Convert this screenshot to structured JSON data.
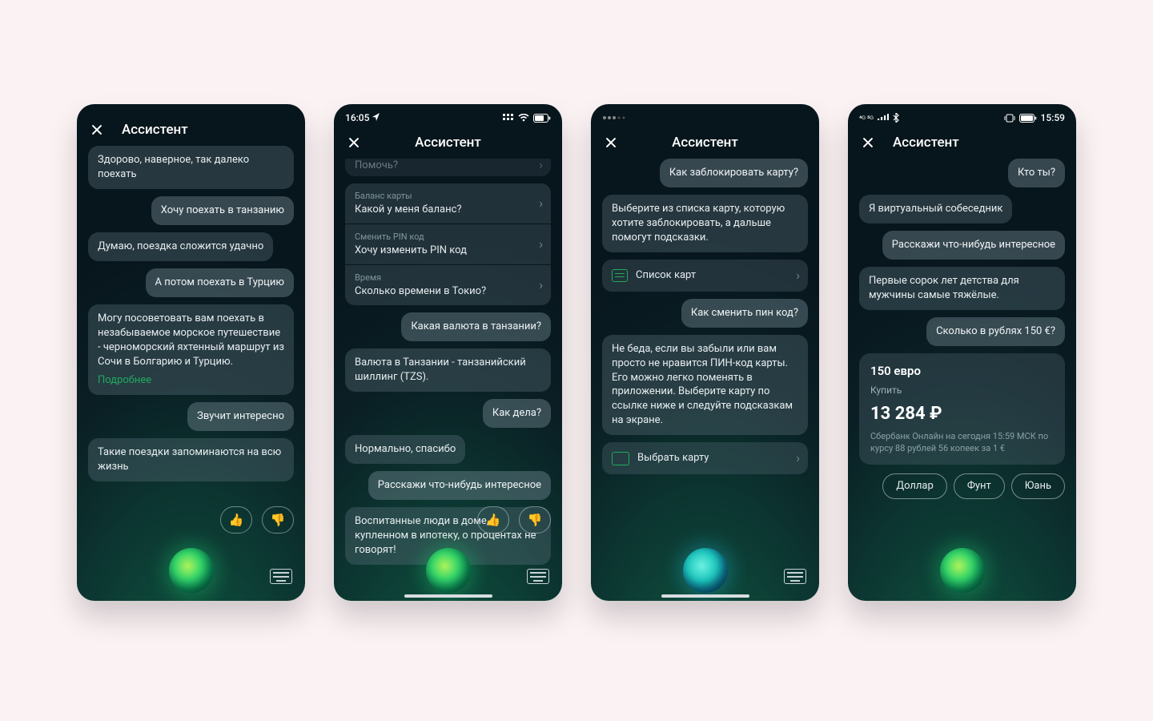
{
  "screens": [
    {
      "layout": "left",
      "title": "Ассистент",
      "statusbar": null,
      "orb": "green",
      "keyboard": true,
      "reactions": true,
      "home_indicator": false,
      "items": [
        {
          "t": "assist",
          "text": "Здорово, наверное, так далеко поехать"
        },
        {
          "t": "user",
          "text": "Хочу поехать в танзанию"
        },
        {
          "t": "assist",
          "text": "Думаю, поездка сложится удачно"
        },
        {
          "t": "user",
          "text": "А потом поехать в Турцию"
        },
        {
          "t": "assist",
          "text": "Могу посоветовать вам поехать в незабываемое морское путешествие - черноморский яхтенный маршрут из Сочи в Болгарию и Турцию.",
          "link": "Подробнее"
        },
        {
          "t": "user",
          "text": "Звучит интересно"
        },
        {
          "t": "assist",
          "text": "Такие поездки запоминаются на всю жизнь"
        }
      ]
    },
    {
      "layout": "center",
      "title": "Ассистент",
      "statusbar": {
        "time": "16:05",
        "icons": [
          "location",
          "grid",
          "wifi",
          "battery70"
        ]
      },
      "orb": "green",
      "keyboard": true,
      "reactions": true,
      "home_indicator": true,
      "items": [
        {
          "t": "peekrow",
          "main": "Помочь?"
        },
        {
          "t": "listrow",
          "caption": "Баланс карты",
          "main": "Какой у меня баланс?",
          "stack": "top"
        },
        {
          "t": "listrow",
          "caption": "Сменить PIN код",
          "main": "Хочу изменить PIN код",
          "stack": "mid"
        },
        {
          "t": "listrow",
          "caption": "Время",
          "main": "Сколько времени в Токио?",
          "stack": "bot"
        },
        {
          "t": "user",
          "text": "Какая валюта в танзании?"
        },
        {
          "t": "assist",
          "text": "Валюта в Танзании - танзанийский шиллинг (TZS)."
        },
        {
          "t": "user",
          "text": "Как дела?"
        },
        {
          "t": "assist",
          "text": "Нормально, спасибо"
        },
        {
          "t": "user",
          "text": "Расскажи что-нибудь интересное"
        },
        {
          "t": "assist",
          "text": "Воспитанные люди в доме, купленном в ипотеку, о процентах\nне говорят!"
        }
      ]
    },
    {
      "layout": "center",
      "title": "Ассистент",
      "statusbar": {
        "time": "",
        "icons": [
          "dots"
        ]
      },
      "orb": "blue",
      "keyboard": true,
      "reactions": false,
      "home_indicator": true,
      "items": [
        {
          "t": "user",
          "text": "Как заблокировать карту?"
        },
        {
          "t": "assist",
          "text": "Выберите из списка карту, которую хотите заблокировать, а дальше помогут подсказки."
        },
        {
          "t": "action",
          "icon": "list",
          "text": "Список карт"
        },
        {
          "t": "user",
          "text": "Как сменить пин код?"
        },
        {
          "t": "assist",
          "text": "Не беда, если вы забыли или вам просто не нравится ПИН-код карты. Его можно легко поменять в приложении. Выберите карту по ссылке ниже и следуйте подсказкам на экране."
        },
        {
          "t": "action",
          "icon": "card",
          "text": "Выбрать карту"
        }
      ]
    },
    {
      "layout": "left",
      "title": "Ассистент",
      "statusbar": {
        "time": "",
        "icons": [
          "sim",
          "signal",
          "bt"
        ],
        "right_text": "15:59",
        "right_icons": [
          "vibe",
          "battery"
        ]
      },
      "orb": "green",
      "keyboard": false,
      "reactions": false,
      "home_indicator": false,
      "items": [
        {
          "t": "user",
          "text": "Кто ты?"
        },
        {
          "t": "assist",
          "text": "Я виртуальный собеседник"
        },
        {
          "t": "user",
          "text": "Расскажи что-нибудь интересное"
        },
        {
          "t": "assist",
          "text": "Первые сорок лет детства для мужчины самые тяжёлые."
        },
        {
          "t": "user",
          "text": "Сколько в рублях 150 €?"
        },
        {
          "t": "infobox",
          "title": "150 евро",
          "sub": "Купить",
          "big": "13 284 ₽",
          "foot": "Сбербанк Онлайн на сегодня 15:59 МСК по курсу 88 рублей 56 копеек за 1 €"
        },
        {
          "t": "chips",
          "items": [
            "Доллар",
            "Фунт",
            "Юань"
          ]
        }
      ]
    }
  ],
  "reactions": {
    "up": "👍",
    "down": "👎"
  }
}
